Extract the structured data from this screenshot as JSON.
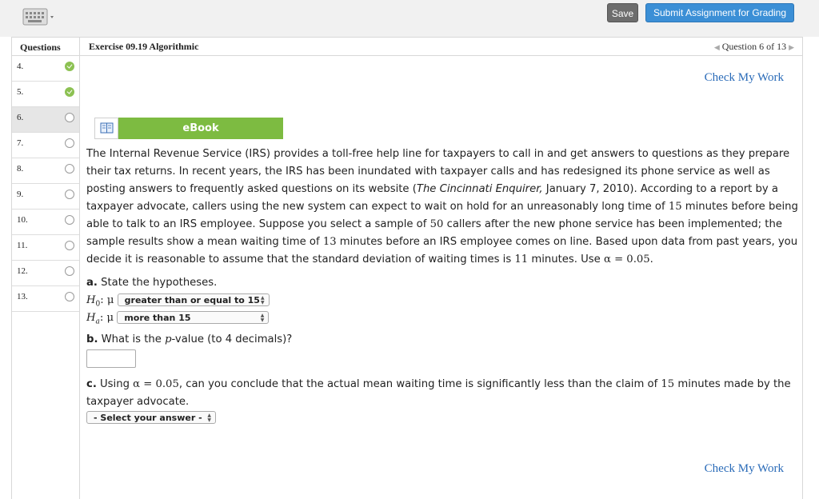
{
  "toolbar": {
    "save_label": "Save",
    "submit_label": "Submit Assignment for Grading",
    "keyboard_icon": "keyboard-icon"
  },
  "sidebar": {
    "header": "Questions",
    "items": [
      {
        "label": "4.",
        "status": "complete"
      },
      {
        "label": "5.",
        "status": "complete"
      },
      {
        "label": "6.",
        "status": "incomplete"
      },
      {
        "label": "7.",
        "status": "incomplete"
      },
      {
        "label": "8.",
        "status": "incomplete"
      },
      {
        "label": "9.",
        "status": "incomplete"
      },
      {
        "label": "10.",
        "status": "incomplete"
      },
      {
        "label": "11.",
        "status": "incomplete"
      },
      {
        "label": "12.",
        "status": "incomplete"
      },
      {
        "label": "13.",
        "status": "incomplete"
      }
    ]
  },
  "header": {
    "exercise_title": "Exercise 09.19 Algorithmic",
    "question_nav": "Question 6 of 13"
  },
  "content": {
    "check_my_work": "Check My Work",
    "ebook_label": "eBook",
    "paragraph": {
      "p1": "The Internal Revenue Service (IRS) provides a toll-free help line for taxpayers to call in and get answers to questions as they prepare their tax returns. In recent years, the IRS has been inundated with taxpayer calls and has redesigned its phone service as well as posting answers to frequently asked questions on its website (",
      "source": "The Cincinnati Enquirer,",
      "p2": " January 7, 2010). According to a report by a taxpayer advocate, callers using the new system can expect to wait on hold for an unreasonably long time of ",
      "n15": "15",
      "p3": " minutes before being able to talk to an IRS employee. Suppose you select a sample of ",
      "n50": "50",
      "p4": " callers after the new phone service has been implemented; the sample results show a mean waiting time of ",
      "n13": "13",
      "p5": " minutes before an IRS employee comes on line. Based upon data from past years, you decide it is reasonable to assume that the standard deviation of waiting times is ",
      "n11": "11",
      "p6": " minutes. Use ",
      "alpha": "α = 0.05",
      "p7": "."
    },
    "part_a": {
      "label": "a.",
      "text": " State the hypotheses.",
      "h0": "H",
      "h0_sub": "0",
      "ha": "H",
      "ha_sub": "a",
      "colon_mu": ": μ",
      "h0_select": "greater than or equal to 15",
      "ha_select": "more than 15"
    },
    "part_b": {
      "label": "b.",
      "t1": " What is the ",
      "p": "p",
      "t2": "-value (to 4 decimals)?",
      "value": ""
    },
    "part_c": {
      "label": "c.",
      "t1": " Using ",
      "alpha": "α = 0.05",
      "t2": ", can you conclude that the actual mean waiting time is significantly less than the claim of ",
      "n15": "15",
      "t3": " minutes made by the",
      "t4": "taxpayer advocate.",
      "select": "- Select your answer -"
    }
  }
}
